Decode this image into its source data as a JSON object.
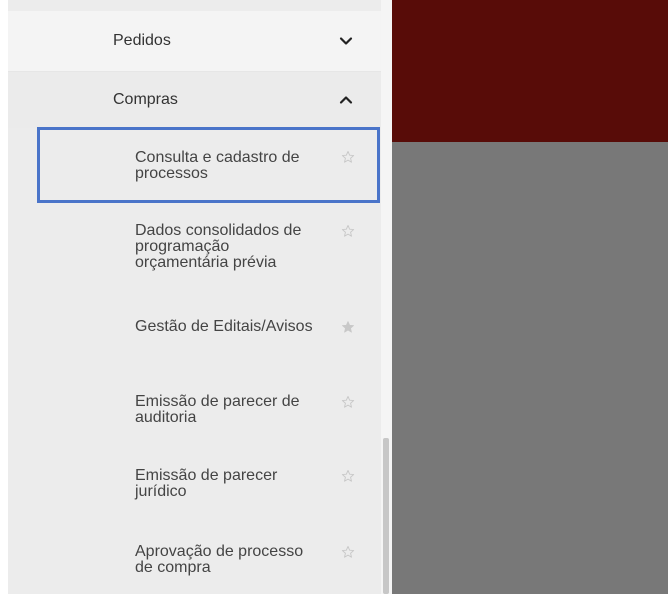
{
  "sidebar": {
    "groups": [
      {
        "label": "Pedidos",
        "expanded": false,
        "chevron_icon": "chevron-down-icon"
      },
      {
        "label": "Compras",
        "expanded": true,
        "chevron_icon": "chevron-up-icon"
      }
    ],
    "items": [
      {
        "label": "Consulta e cadastro de processos",
        "favorite": false,
        "star_icon": "star-outline-icon",
        "focused": true
      },
      {
        "label": "Dados consolidados de programação orçamentária prévia",
        "favorite": false,
        "star_icon": "star-outline-icon"
      },
      {
        "label": "Gestão de Editais/Avisos",
        "favorite": true,
        "star_icon": "star-filled-icon"
      },
      {
        "label": "Emissão de parecer de auditoria",
        "favorite": false,
        "star_icon": "star-outline-icon"
      },
      {
        "label": "Emissão de parecer jurídico",
        "favorite": false,
        "star_icon": "star-outline-icon"
      },
      {
        "label": "Aprovação de processo de compra",
        "favorite": false,
        "star_icon": "star-outline-icon"
      }
    ]
  },
  "colors": {
    "header_bar": "#580c08",
    "overlay": "#787878",
    "focus_ring": "#4a74c9",
    "menu_bg": "#ececec",
    "text": "#444444",
    "star": "#c8c8c8"
  }
}
